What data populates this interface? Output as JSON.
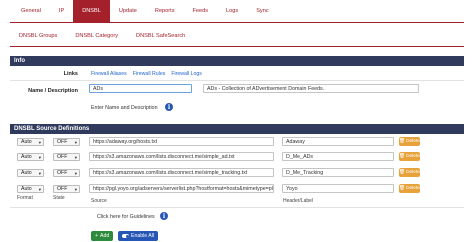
{
  "top_tabs": [
    {
      "label": "General"
    },
    {
      "label": "IP"
    },
    {
      "label": "DNSBL"
    },
    {
      "label": "Update"
    },
    {
      "label": "Reports"
    },
    {
      "label": "Feeds"
    },
    {
      "label": "Logs"
    },
    {
      "label": "Sync"
    }
  ],
  "top_tabs_active": "DNSBL",
  "sub_tabs": [
    {
      "label": "DNSBL Groups"
    },
    {
      "label": "DNSBL Category"
    },
    {
      "label": "DNSBL SafeSearch"
    }
  ],
  "info_panel": {
    "title": "Info",
    "links_label": "Links",
    "links": [
      "Firewall Aliases",
      "Firewall Rules",
      "Firewall Logs"
    ],
    "name_desc_label": "Name / Description",
    "name_value": "ADs",
    "description_value": "ADs - Collection of ADvertisement Domain Feeds.",
    "name_hint": "Enter Name and Description"
  },
  "source_panel": {
    "title": "DNSBL Source Definitions",
    "rows": [
      {
        "format": "Auto",
        "state": "OFF",
        "source": "https://adaway.org/hosts.txt",
        "header": "Adaway",
        "delete_label": "Delete"
      },
      {
        "format": "Auto",
        "state": "OFF",
        "source": "https://s3.amazonaws.com/lists.disconnect.me/simple_ad.txt",
        "header": "D_Me_ADs",
        "delete_label": "Delete"
      },
      {
        "format": "Auto",
        "state": "OFF",
        "source": "https://s3.amazonaws.com/lists.disconnect.me/simple_tracking.txt",
        "header": "D_Me_Tracking",
        "delete_label": "Delete"
      },
      {
        "format": "Auto",
        "state": "OFF",
        "source": "https://pgl.yoyo.org/adservers/serverlist.php?hostformat=hosts&mimetype=plaintext",
        "header": "Yoyo",
        "delete_label": "Delete"
      }
    ],
    "footer_labels": {
      "format": "Format",
      "state": "State",
      "source": "Source",
      "header": "Header/Label"
    },
    "guidelines_text": "Click here for Guidelines",
    "add_label": "Add",
    "enable_all_label": "Enable All"
  },
  "colors": {
    "accent": "#a4212b",
    "panel_header": "#2f3a5c",
    "info": "#2657b5",
    "delete": "#e8a23a",
    "add": "#2e8b3e"
  }
}
